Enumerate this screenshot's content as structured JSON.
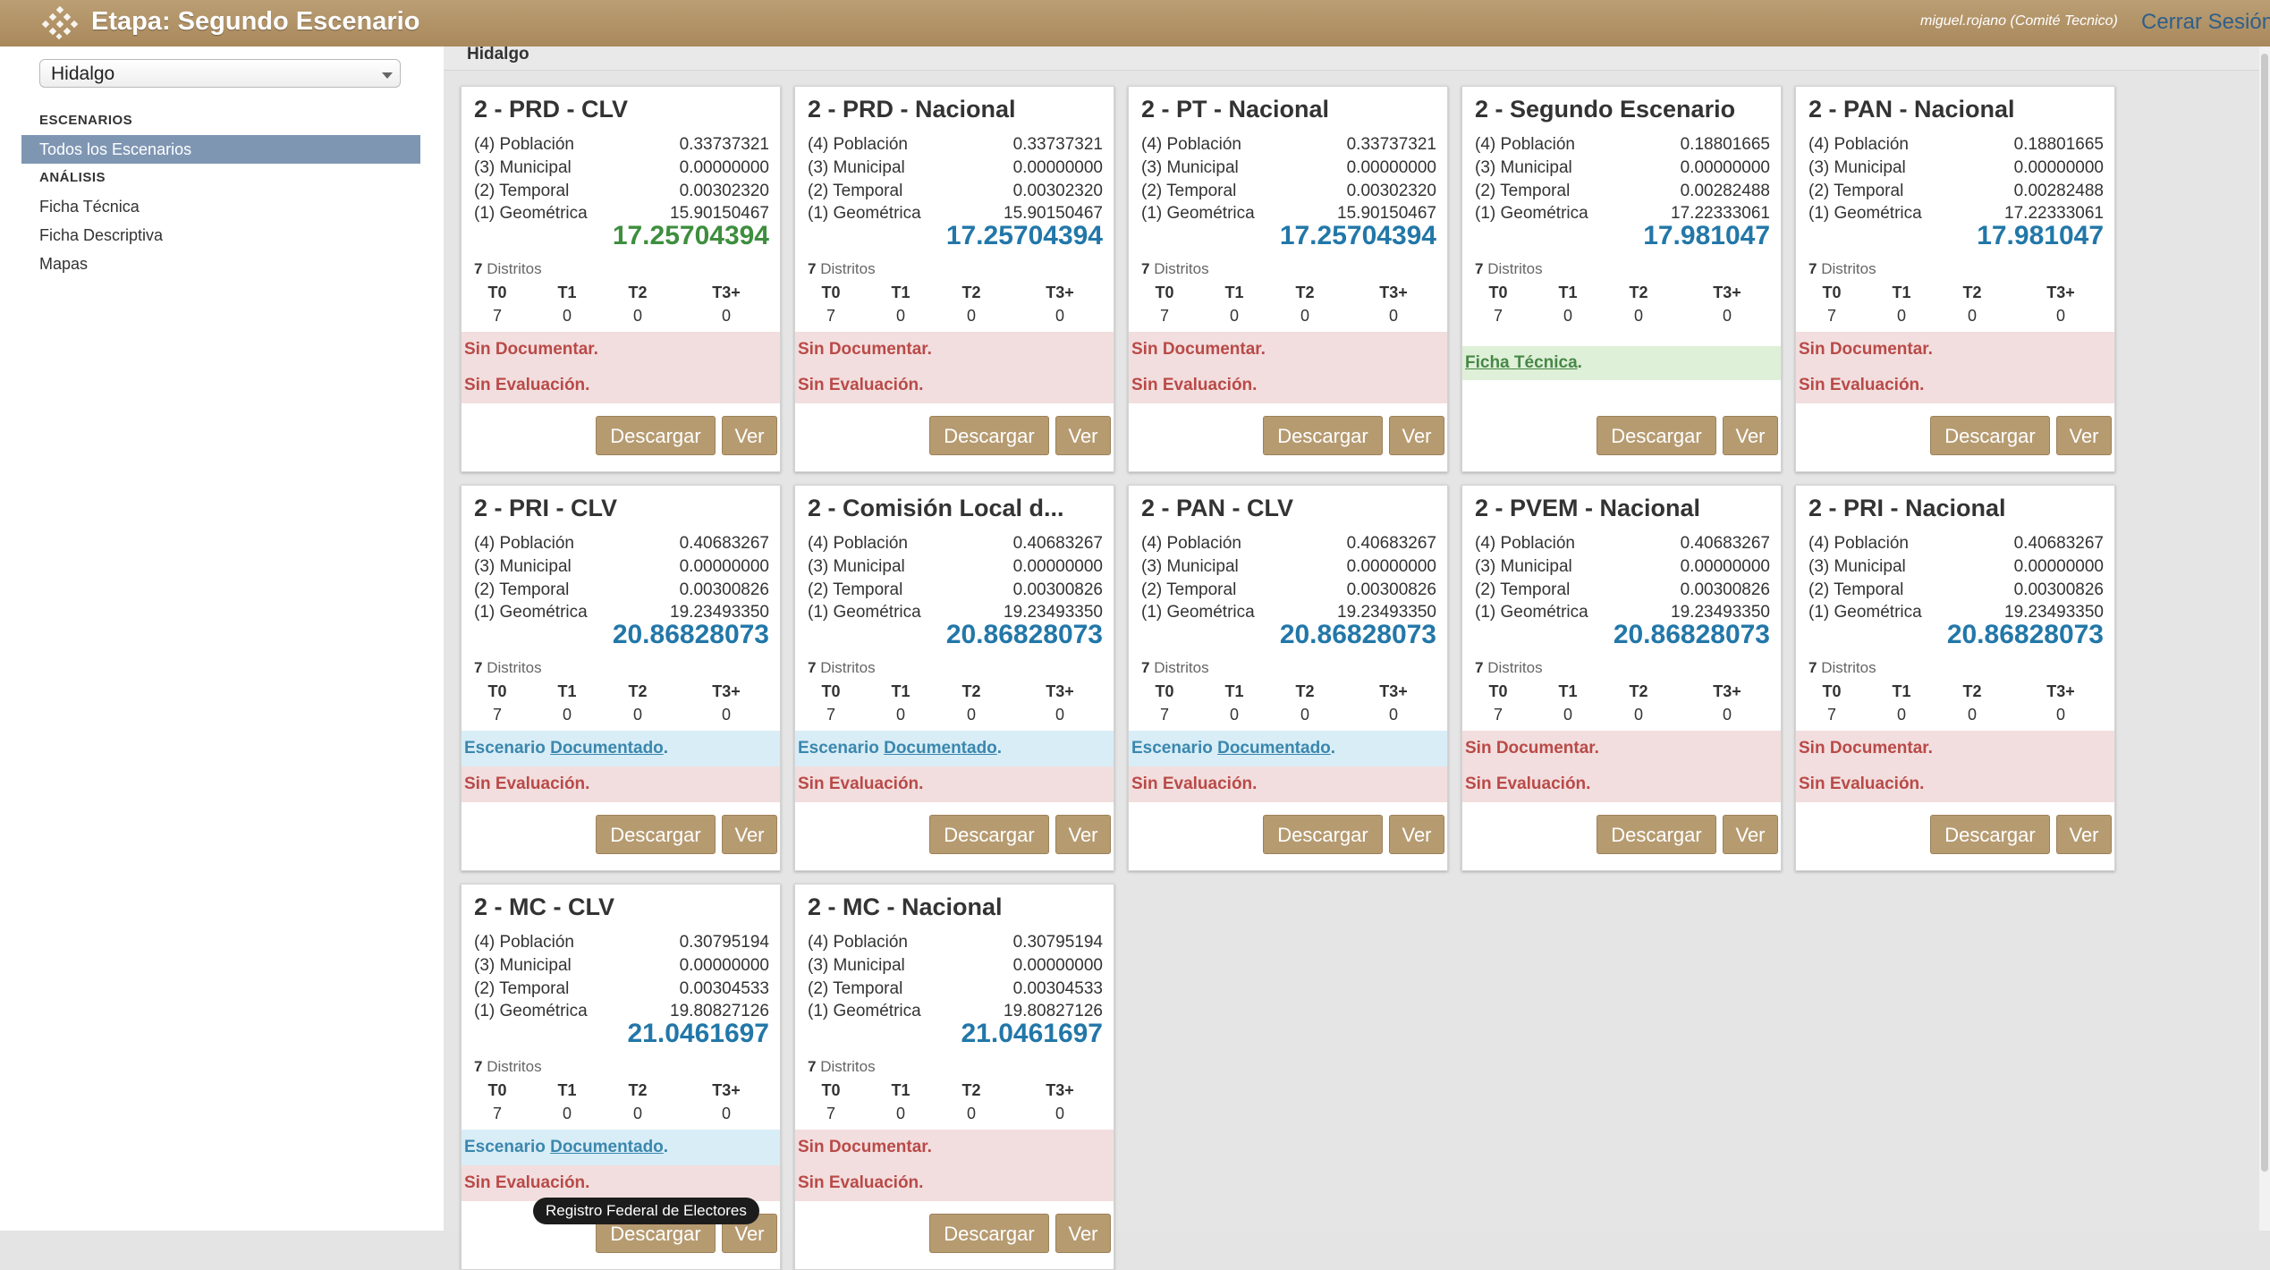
{
  "header": {
    "title": "Etapa: Segundo Escenario",
    "user": "miguel.rojano (Comité Tecnico)",
    "logout_label": "Cerrar Sesión",
    "brand_color": "#b09264"
  },
  "sidebar": {
    "state_select": {
      "value": "Hidalgo"
    },
    "section_scenarios": "ESCENARIOS",
    "all_scenarios": "Todos los Escenarios",
    "section_analysis": "ANÁLISIS",
    "items": [
      "Ficha Técnica",
      "Ficha Descriptiva",
      "Mapas"
    ]
  },
  "breadcrumb": "Hidalgo",
  "labels": {
    "poblacion": "(4) Población",
    "municipal": "(3) Municipal",
    "temporal": "(2) Temporal",
    "geometrica": "(1) Geométrica",
    "distritos": "Distritos",
    "t_headers": [
      "T0",
      "T1",
      "T2",
      "T3+"
    ],
    "download": "Descargar",
    "view": "Ver",
    "sin_documentar": "Sin Documentar.",
    "sin_evaluacion": "Sin Evaluación.",
    "escenario_prefix": "Escenario",
    "documentado": "Documentado",
    "ficha_tecnica": "Ficha Técnica",
    "period": "."
  },
  "cards": [
    {
      "title": "2 - PRD - CLV",
      "poblacion": "0.33737321",
      "municipal": "0.00000000",
      "temporal": "0.00302320",
      "geometrica": "15.90150467",
      "total": "17.25704394",
      "total_color": "green",
      "districts": "7",
      "t": [
        "7",
        "0",
        "0",
        "0"
      ],
      "doc": "none",
      "eval": "none"
    },
    {
      "title": "2 - PRD - Nacional",
      "poblacion": "0.33737321",
      "municipal": "0.00000000",
      "temporal": "0.00302320",
      "geometrica": "15.90150467",
      "total": "17.25704394",
      "total_color": "blue",
      "districts": "7",
      "t": [
        "7",
        "0",
        "0",
        "0"
      ],
      "doc": "none",
      "eval": "none"
    },
    {
      "title": "2 - PT - Nacional",
      "poblacion": "0.33737321",
      "municipal": "0.00000000",
      "temporal": "0.00302320",
      "geometrica": "15.90150467",
      "total": "17.25704394",
      "total_color": "blue",
      "districts": "7",
      "t": [
        "7",
        "0",
        "0",
        "0"
      ],
      "doc": "none",
      "eval": "none"
    },
    {
      "title": "2 - Segundo Escenario",
      "poblacion": "0.18801665",
      "municipal": "0.00000000",
      "temporal": "0.00282488",
      "geometrica": "17.22333061",
      "total": "17.981047",
      "total_color": "blue",
      "districts": "7",
      "t": [
        "7",
        "0",
        "0",
        "0"
      ],
      "doc": "ficha",
      "eval": "hidden"
    },
    {
      "title": "2 - PAN - Nacional",
      "poblacion": "0.18801665",
      "municipal": "0.00000000",
      "temporal": "0.00282488",
      "geometrica": "17.22333061",
      "total": "17.981047",
      "total_color": "blue",
      "districts": "7",
      "t": [
        "7",
        "0",
        "0",
        "0"
      ],
      "doc": "none",
      "eval": "none"
    },
    {
      "title": "2 - PRI - CLV",
      "poblacion": "0.40683267",
      "municipal": "0.00000000",
      "temporal": "0.00300826",
      "geometrica": "19.23493350",
      "total": "20.86828073",
      "total_color": "blue",
      "districts": "7",
      "t": [
        "7",
        "0",
        "0",
        "0"
      ],
      "doc": "documented",
      "eval": "none"
    },
    {
      "title": "2 - Comisión Local d...",
      "poblacion": "0.40683267",
      "municipal": "0.00000000",
      "temporal": "0.00300826",
      "geometrica": "19.23493350",
      "total": "20.86828073",
      "total_color": "blue",
      "districts": "7",
      "t": [
        "7",
        "0",
        "0",
        "0"
      ],
      "doc": "documented",
      "eval": "none"
    },
    {
      "title": "2 - PAN - CLV",
      "poblacion": "0.40683267",
      "municipal": "0.00000000",
      "temporal": "0.00300826",
      "geometrica": "19.23493350",
      "total": "20.86828073",
      "total_color": "blue",
      "districts": "7",
      "t": [
        "7",
        "0",
        "0",
        "0"
      ],
      "doc": "documented",
      "eval": "none"
    },
    {
      "title": "2 - PVEM - Nacional",
      "poblacion": "0.40683267",
      "municipal": "0.00000000",
      "temporal": "0.00300826",
      "geometrica": "19.23493350",
      "total": "20.86828073",
      "total_color": "blue",
      "districts": "7",
      "t": [
        "7",
        "0",
        "0",
        "0"
      ],
      "doc": "none",
      "eval": "none"
    },
    {
      "title": "2 - PRI - Nacional",
      "poblacion": "0.40683267",
      "municipal": "0.00000000",
      "temporal": "0.00300826",
      "geometrica": "19.23493350",
      "total": "20.86828073",
      "total_color": "blue",
      "districts": "7",
      "t": [
        "7",
        "0",
        "0",
        "0"
      ],
      "doc": "none",
      "eval": "none"
    },
    {
      "title": "2 - MC - CLV",
      "poblacion": "0.30795194",
      "municipal": "0.00000000",
      "temporal": "0.00304533",
      "geometrica": "19.80827126",
      "total": "21.0461697",
      "total_color": "blue",
      "districts": "7",
      "t": [
        "7",
        "0",
        "0",
        "0"
      ],
      "doc": "documented",
      "eval": "none"
    },
    {
      "title": "2 - MC - Nacional",
      "poblacion": "0.30795194",
      "municipal": "0.00000000",
      "temporal": "0.00304533",
      "geometrica": "19.80827126",
      "total": "21.0461697",
      "total_color": "blue",
      "districts": "7",
      "t": [
        "7",
        "0",
        "0",
        "0"
      ],
      "doc": "none",
      "eval": "none"
    }
  ],
  "tooltip": "Registro Federal de Electores"
}
